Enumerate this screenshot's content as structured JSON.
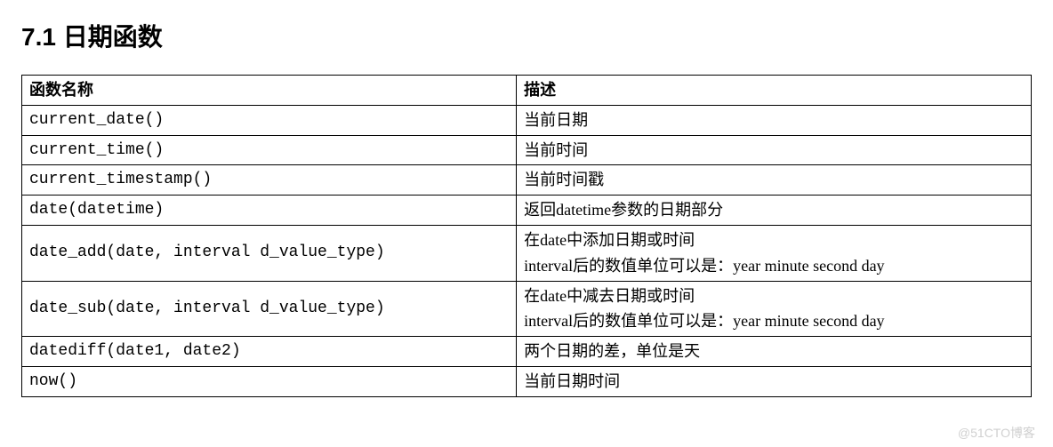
{
  "heading": "7.1 日期函数",
  "table": {
    "headers": {
      "func": "函数名称",
      "desc": "描述"
    },
    "rows": [
      {
        "func": "current_date()",
        "desc": "当前日期"
      },
      {
        "func": "current_time()",
        "desc": "当前时间"
      },
      {
        "func": "current_timestamp()",
        "desc": "当前时间戳"
      },
      {
        "func": "date(datetime)",
        "desc": "返回datetime参数的日期部分"
      },
      {
        "func": "date_add(date, interval d_value_type)",
        "desc": "在date中添加日期或时间\ninterval后的数值单位可以是：year minute second day"
      },
      {
        "func": "date_sub(date, interval d_value_type)",
        "desc": "在date中减去日期或时间\ninterval后的数值单位可以是：year minute second day"
      },
      {
        "func": "datediff(date1, date2)",
        "desc": "两个日期的差，单位是天"
      },
      {
        "func": "now()",
        "desc": "当前日期时间"
      }
    ]
  },
  "watermark": "@51CTO博客"
}
